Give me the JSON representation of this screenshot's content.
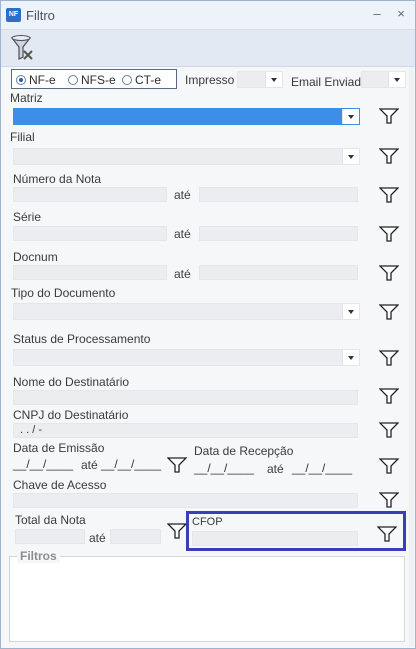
{
  "window": {
    "title": "Filtro",
    "app_icon_text": "NF"
  },
  "title_buttons": {
    "minimize": "–",
    "close": "×"
  },
  "doc_type": {
    "options": [
      "NF-e",
      "NFS-e",
      "CT-e"
    ],
    "selected": "NF-e"
  },
  "impresso": {
    "label": "Impresso",
    "value": ""
  },
  "email_enviado": {
    "label": "Email Enviado",
    "value": ""
  },
  "matriz": {
    "label": "Matriz",
    "value": ""
  },
  "filial": {
    "label": "Filial",
    "value": ""
  },
  "numero_nota": {
    "label": "Número da Nota",
    "ate": "até",
    "from": "",
    "to": ""
  },
  "serie": {
    "label": "Série",
    "ate": "até",
    "from": "",
    "to": ""
  },
  "docnum": {
    "label": "Docnum",
    "ate": "até",
    "from": "",
    "to": ""
  },
  "tipo_documento": {
    "label": "Tipo do Documento",
    "value": ""
  },
  "status_processamento": {
    "label": "Status de Processamento",
    "value": ""
  },
  "nome_destinatario": {
    "label": "Nome do Destinatário",
    "value": ""
  },
  "cnpj_destinatario": {
    "label": "CNPJ do Destinatário",
    "mask": " .   .   /    -"
  },
  "data_emissao": {
    "label": "Data de Emissão",
    "ate": "até",
    "from": "__/__/____",
    "to": "__/__/____"
  },
  "data_recepcao": {
    "label": "Data de Recepção",
    "ate": "até",
    "from": "__/__/____",
    "to": "__/__/____"
  },
  "chave_acesso": {
    "label": "Chave de Acesso",
    "value": ""
  },
  "total_nota": {
    "label": "Total da Nota",
    "ate": "até",
    "from": "",
    "to": ""
  },
  "cfop": {
    "label": "CFOP",
    "value": ""
  },
  "filtros": {
    "label": "Filtros"
  },
  "colors": {
    "accent_selected": "#3d8ee8",
    "highlight_border": "#3a3fb5",
    "field_bg": "#ebedf0"
  },
  "icons": {
    "filter": "funnel-icon",
    "toolbar": "funnel-clear-icon"
  }
}
